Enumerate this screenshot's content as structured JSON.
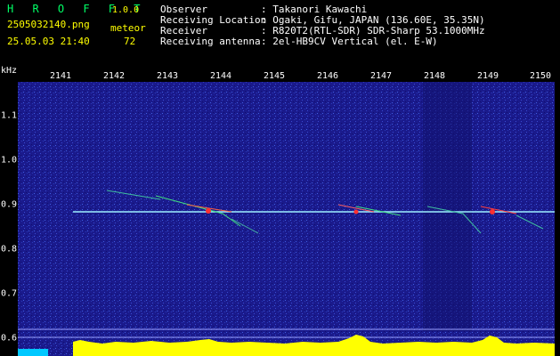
{
  "header": {
    "app_title": "H R O F F T",
    "version": "1.0.0",
    "filename": "2505032140.png",
    "meteor_label": "meteor",
    "datetime": "25.05.03 21:40",
    "meteor_count": "72",
    "info_labels": [
      "Observer",
      "Receiving Location",
      "Receiver",
      "Receiving antenna"
    ],
    "info_values": [
      ": Takanori Kawachi",
      ": Ogaki, Gifu, JAPAN (136.60E, 35.35N)",
      ": R820T2(RTL-SDR) SDR-Sharp 53.1000MHz",
      ": 2el-HB9CV Vertical (el. E-W)"
    ]
  },
  "axis": {
    "y_unit": "kHz",
    "y_ticks": [
      "1.1",
      "1.0",
      "0.9",
      "0.8",
      "0.7",
      "0.6"
    ],
    "x_ticks": [
      "2141",
      "2142",
      "2143",
      "2144",
      "2145",
      "2146",
      "2147",
      "2148",
      "2149",
      "2150"
    ]
  },
  "colors": {
    "background": "#1a1a8c",
    "signal": "#ffff00",
    "carrier": "#9cf0ff",
    "meteor_head": "#ff3030"
  }
}
